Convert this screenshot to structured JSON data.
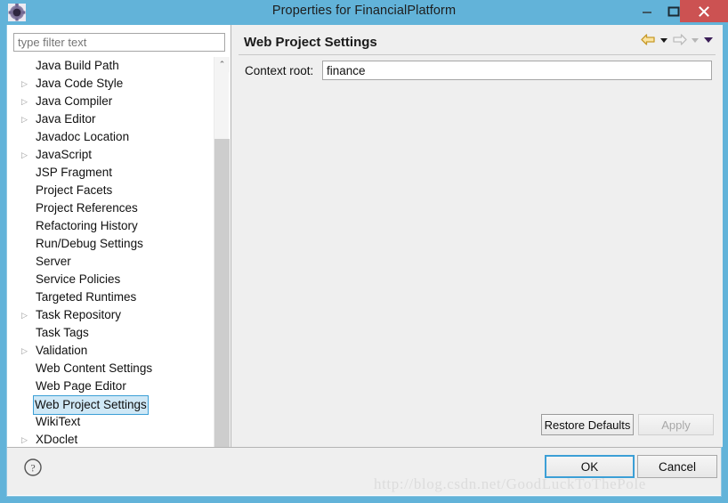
{
  "window": {
    "title": "Properties for FinancialPlatform",
    "icon": "gear-icon",
    "accent_color": "#62b3d9",
    "close_color": "#cc5252",
    "controls": {
      "minimize": "–",
      "maximize": "□",
      "close": "×"
    }
  },
  "filter": {
    "placeholder": "type filter text",
    "value": ""
  },
  "tree": {
    "selected": "Web Project Settings",
    "items": [
      {
        "label": "Java Build Path",
        "expandable": false,
        "selected": false
      },
      {
        "label": "Java Code Style",
        "expandable": true,
        "selected": false
      },
      {
        "label": "Java Compiler",
        "expandable": true,
        "selected": false
      },
      {
        "label": "Java Editor",
        "expandable": true,
        "selected": false
      },
      {
        "label": "Javadoc Location",
        "expandable": false,
        "selected": false
      },
      {
        "label": "JavaScript",
        "expandable": true,
        "selected": false
      },
      {
        "label": "JSP Fragment",
        "expandable": false,
        "selected": false
      },
      {
        "label": "Project Facets",
        "expandable": false,
        "selected": false
      },
      {
        "label": "Project References",
        "expandable": false,
        "selected": false
      },
      {
        "label": "Refactoring History",
        "expandable": false,
        "selected": false
      },
      {
        "label": "Run/Debug Settings",
        "expandable": false,
        "selected": false
      },
      {
        "label": "Server",
        "expandable": false,
        "selected": false
      },
      {
        "label": "Service Policies",
        "expandable": false,
        "selected": false
      },
      {
        "label": "Targeted Runtimes",
        "expandable": false,
        "selected": false
      },
      {
        "label": "Task Repository",
        "expandable": true,
        "selected": false
      },
      {
        "label": "Task Tags",
        "expandable": false,
        "selected": false
      },
      {
        "label": "Validation",
        "expandable": true,
        "selected": false
      },
      {
        "label": "Web Content Settings",
        "expandable": false,
        "selected": false
      },
      {
        "label": "Web Page Editor",
        "expandable": false,
        "selected": false
      },
      {
        "label": "Web Project Settings",
        "expandable": false,
        "selected": true
      },
      {
        "label": "WikiText",
        "expandable": false,
        "selected": false
      },
      {
        "label": "XDoclet",
        "expandable": true,
        "selected": false
      }
    ],
    "twisty_glyph": "▷",
    "scrollbar": {
      "up_glyph": "⌃",
      "down_glyph": "⌄"
    }
  },
  "page": {
    "title": "Web Project Settings",
    "context_root_label": "Context root:",
    "context_root_value": "finance",
    "nav": {
      "back_icon": "back-arrow-icon",
      "back_menu_icon": "chevron-down-icon",
      "forward_icon": "forward-arrow-icon",
      "forward_menu_icon": "chevron-down-icon",
      "menu_icon": "chevron-down-icon",
      "back_color": "#f0c24b",
      "forward_color": "#c8c8c8",
      "menu_color": "#3b1e57"
    },
    "restore_defaults_label": "Restore Defaults",
    "apply_label": "Apply",
    "apply_enabled": false
  },
  "footer": {
    "help_icon": "help-question-icon",
    "ok_label": "OK",
    "cancel_label": "Cancel",
    "watermark": "http://blog.csdn.net/GoodLuckToThePole"
  }
}
